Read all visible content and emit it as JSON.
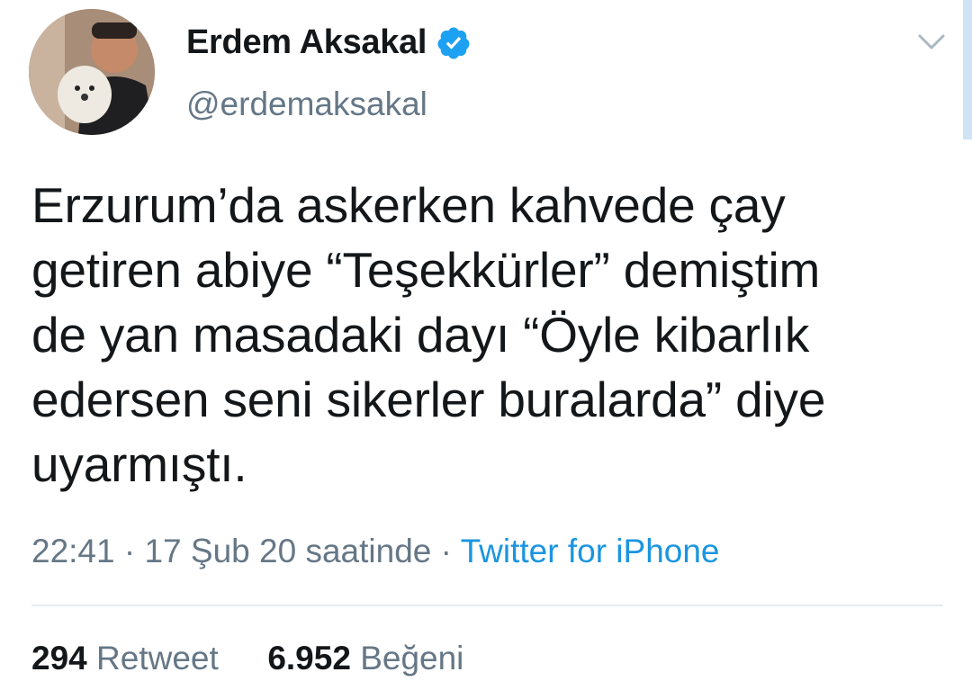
{
  "author": {
    "display_name": "Erdem Aksakal",
    "handle": "@erdemaksakal",
    "verified": true
  },
  "tweet": {
    "text": "Erzurum’da askerken kahvede çay\ngetiren abiye “Teşekkürler” demiştim\nde yan masadaki dayı “Öyle kibarlık\nedersen seni sikerler buralarda” diye\nuyarmıştı.",
    "time": "22:41",
    "separator": "·",
    "date": "17 Şub 20 saatinde",
    "source": "Twitter for iPhone"
  },
  "stats": {
    "retweets_count": "294",
    "retweets_label": "Retweet",
    "likes_count": "6.952",
    "likes_label": "Beğeni"
  },
  "colors": {
    "text": "#14171a",
    "secondary": "#657786",
    "accent": "#1b95e0",
    "divider": "#e6ecf0"
  },
  "icons": {
    "verified": "verified-badge-icon",
    "more": "chevron-down-icon"
  }
}
